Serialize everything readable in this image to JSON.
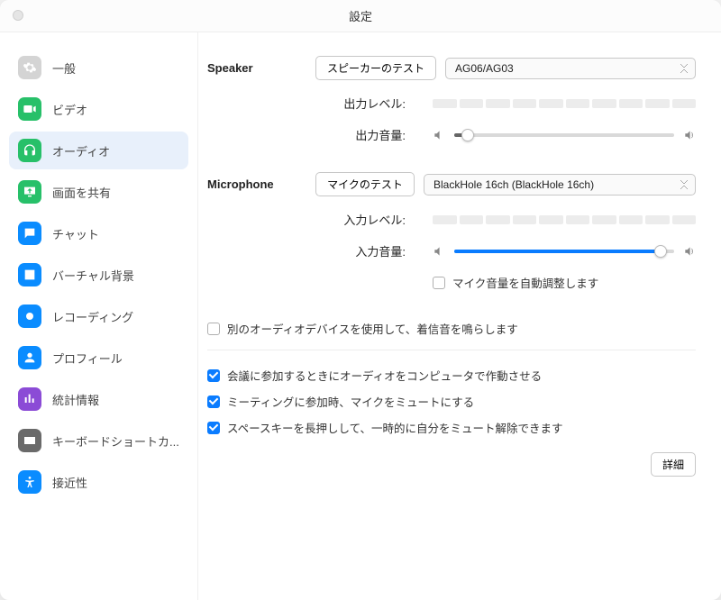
{
  "title": "設定",
  "sidebar": {
    "items": [
      {
        "label": "一般",
        "color": "#d4d4d4"
      },
      {
        "label": "ビデオ",
        "color": "#27c069"
      },
      {
        "label": "オーディオ",
        "color": "#27c069"
      },
      {
        "label": "画面を共有",
        "color": "#27c069"
      },
      {
        "label": "チャット",
        "color": "#0a8cff"
      },
      {
        "label": "バーチャル背景",
        "color": "#0a8cff"
      },
      {
        "label": "レコーディング",
        "color": "#0a8cff"
      },
      {
        "label": "プロフィール",
        "color": "#0a8cff"
      },
      {
        "label": "統計情報",
        "color": "#8b4bd6"
      },
      {
        "label": "キーボードショートカ...",
        "color": "#6a6a6a"
      },
      {
        "label": "接近性",
        "color": "#0a8cff"
      }
    ],
    "activeIndex": 2
  },
  "speaker": {
    "section": "Speaker",
    "testBtn": "スピーカーのテスト",
    "device": "AG06/AG03",
    "outLevelLabel": "出力レベル:",
    "outVolLabel": "出力音量:",
    "volumePct": 6
  },
  "microphone": {
    "section": "Microphone",
    "testBtn": "マイクのテスト",
    "device": "BlackHole 16ch (BlackHole 16ch)",
    "inLevelLabel": "入力レベル:",
    "inVolLabel": "入力音量:",
    "volumePct": 94,
    "autoAdjustLabel": "マイク音量を自動調整します",
    "autoAdjustChecked": false
  },
  "ringtone": {
    "label": "別のオーディオデバイスを使用して、着信音を鳴らします",
    "checked": false
  },
  "options": [
    {
      "label": "会議に参加するときにオーディオをコンピュータで作動させる",
      "checked": true
    },
    {
      "label": "ミーティングに参加時、マイクをミュートにする",
      "checked": true
    },
    {
      "label": "スペースキーを長押しして、一時的に自分をミュート解除できます",
      "checked": true
    }
  ],
  "advancedBtn": "詳細"
}
